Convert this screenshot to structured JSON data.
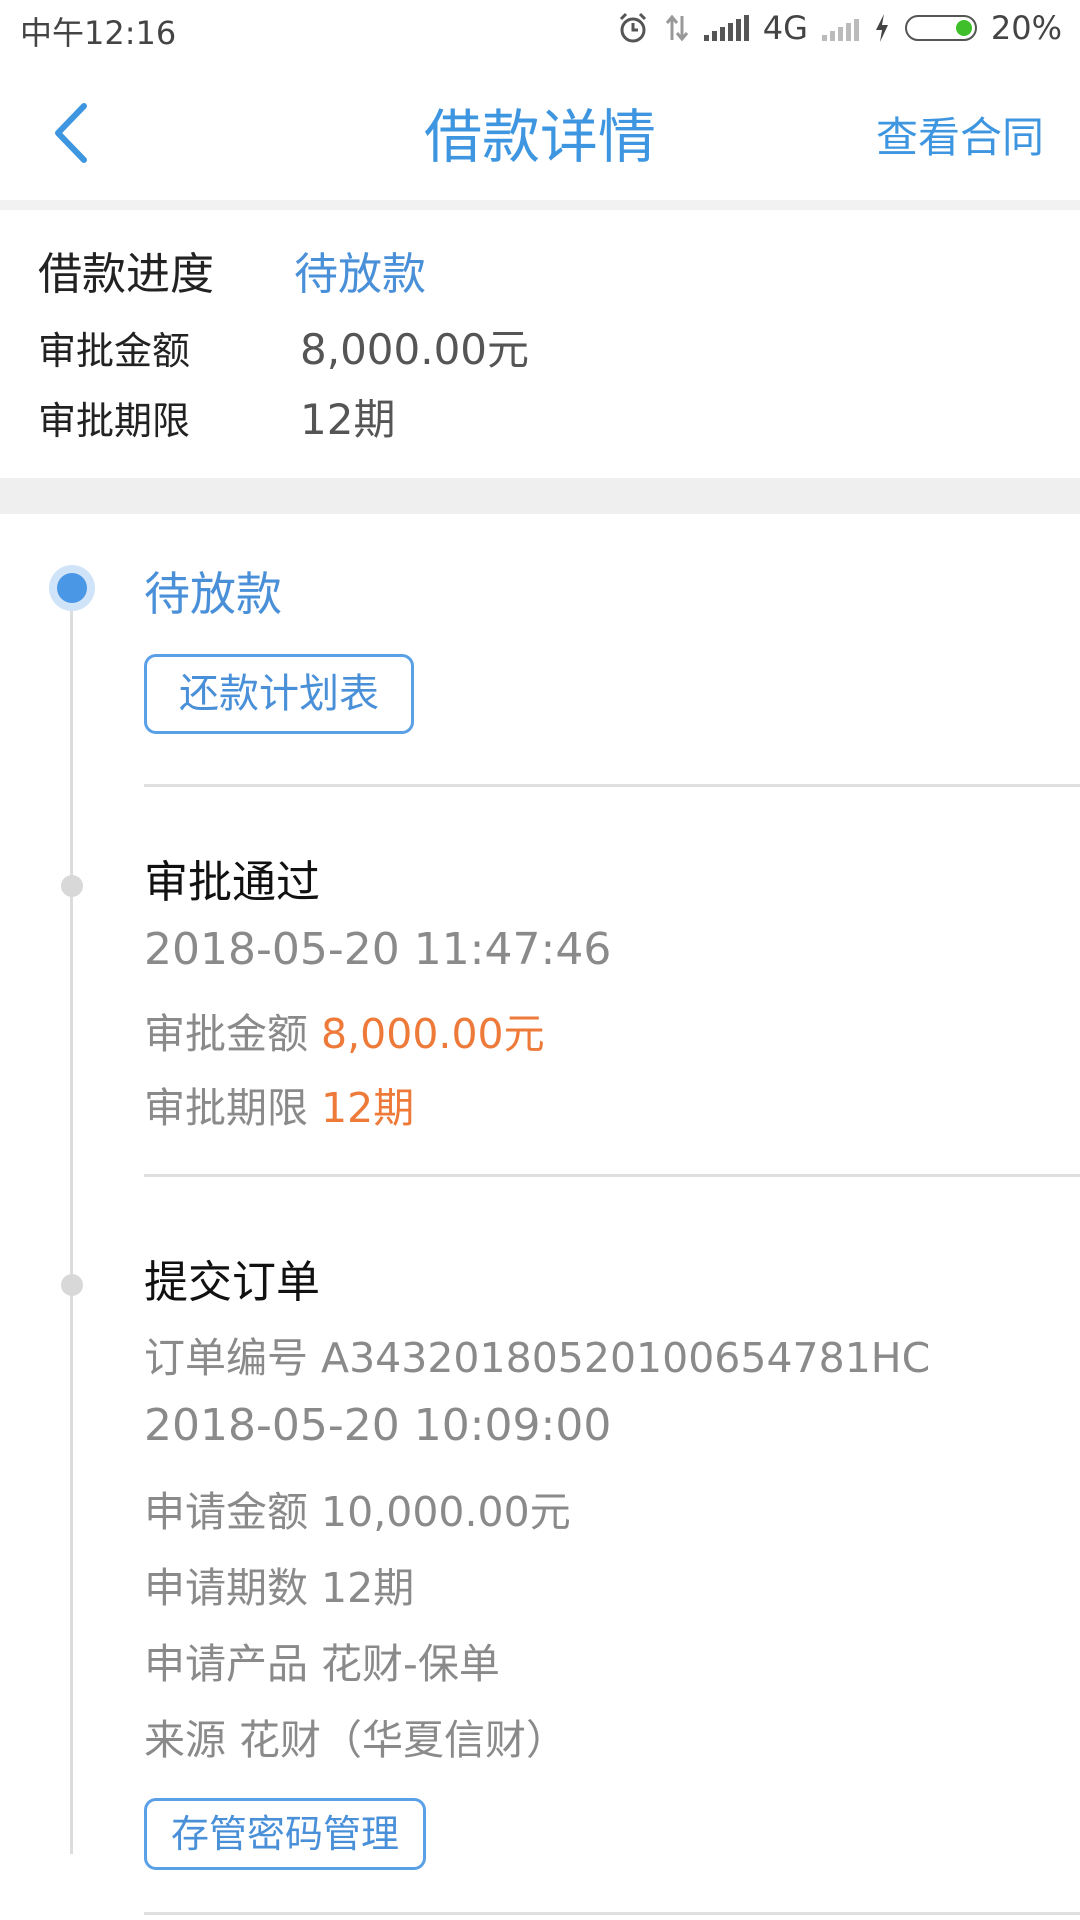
{
  "status_bar": {
    "time": "中午12:16",
    "network": "4G",
    "battery": "20%",
    "icons": [
      "alarm-icon",
      "data-arrows-icon",
      "signal-icon",
      "no-signal-icon",
      "charging-icon",
      "battery-icon"
    ]
  },
  "header": {
    "title": "借款详情",
    "contract_link": "查看合同",
    "back_icon": "chevron-left-icon"
  },
  "summary": {
    "progress_label": "借款进度",
    "progress_value": "待放款",
    "amount_label": "审批金额",
    "amount_value": "8,000.00元",
    "term_label": "审批期限",
    "term_value": "12期"
  },
  "timeline": {
    "pending": {
      "title": "待放款",
      "plan_button": "还款计划表"
    },
    "approved": {
      "title": "审批通过",
      "datetime": "2018-05-20 11:47:46",
      "amount_label": "审批金额",
      "amount_value": "8,000.00元",
      "term_label": "审批期限",
      "term_value": "12期"
    },
    "submitted": {
      "title": "提交订单",
      "order_label": "订单编号",
      "order_no": "A34320180520100654781HC",
      "datetime": "2018-05-20 10:09:00",
      "apply_amount_label": "申请金额",
      "apply_amount_value": "10,000.00元",
      "apply_term_label": "申请期数",
      "apply_term_value": "12期",
      "product_label": "申请产品",
      "product_value": "花财-保单",
      "source_label": "来源",
      "source_value": "花财（华夏信财）",
      "password_button": "存管密码管理"
    }
  },
  "colors": {
    "accent": "#3f96e0",
    "highlight": "#ee7a3a",
    "muted": "#8a8a8a"
  }
}
